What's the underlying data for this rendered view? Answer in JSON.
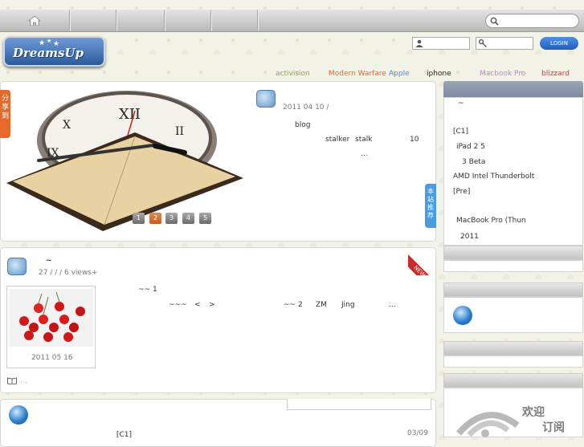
{
  "tags": [
    {
      "label": "activision",
      "color": "#8aa83a"
    },
    {
      "label": "Modern Warfare",
      "color": "#e06a3a"
    },
    {
      "label": "Apple",
      "color": "#4a8ad6"
    },
    {
      "label": "iphone",
      "color": "#222222"
    },
    {
      "label": "Macbook Pro",
      "color": "#b489c8"
    },
    {
      "label": "blizzard",
      "color": "#d63a3a"
    }
  ],
  "header": {
    "login_label": "LOGIN"
  },
  "share_tab": "分享到",
  "featured": {
    "date": "2011 04 10 /",
    "line1": "blog",
    "line2a": "stalker",
    "line2b": "stalk",
    "line2c": "10",
    "line3": "...",
    "pages": [
      "1",
      "2",
      "3",
      "4",
      "5"
    ],
    "recommend_tab": "本站推荐"
  },
  "post": {
    "title": "~",
    "meta": "27 / / / 6 views+",
    "new_badge": "NEW",
    "img_date": "2011 05 16",
    "text1": "~~ 1",
    "text2a": "~~~",
    "text2b": "<",
    "text2c": ">",
    "text2d": "~~ 2",
    "text2e": "ZM",
    "text2f": "Jing",
    "text2g": "...",
    "footer": ". ."
  },
  "sidebar": {
    "list": [
      "~",
      "[C1]",
      "iPad 2 5",
      "3 Beta",
      "AMD Intel Thunderbolt",
      "[Pre]",
      "MacBook Pro (Thun",
      "2011"
    ]
  },
  "bottom": {
    "date": "03/09",
    "item": "[C1]"
  },
  "subscribe": {
    "line1": "欢迎",
    "line2": "订阅"
  },
  "colors": {
    "accent": "#4a7fae",
    "orange": "#e56a2a"
  }
}
